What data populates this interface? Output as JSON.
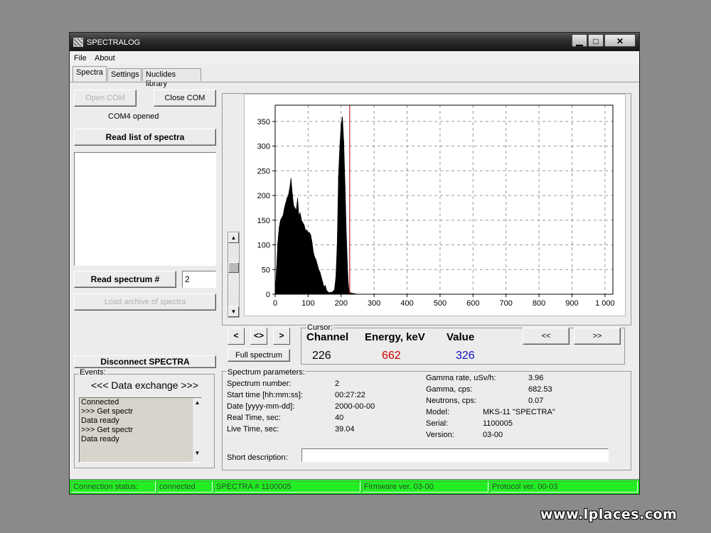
{
  "window": {
    "title": "SPECTRALOG",
    "controls": {
      "minimize": "▁",
      "maximize": "□",
      "close": "✕"
    }
  },
  "menu": [
    "File",
    "About"
  ],
  "tabs": [
    "Spectra",
    "Settings",
    "Nuclides library"
  ],
  "left_panel": {
    "open_com": "Open COM",
    "close_com": "Close COM",
    "com_status": "COM4 opened",
    "read_list": "Read list of spectra",
    "read_spectrum": "Read spectrum #",
    "spectrum_number_value": "2",
    "load_archive": "Load archive of spectra",
    "disconnect": "Disconnect SPECTRA",
    "events_label": "Events:",
    "data_exchange": "<<< Data exchange >>>",
    "events": [
      "Connected",
      ">>> Get spectr",
      "Data ready",
      ">>> Get spectr",
      "Data ready"
    ]
  },
  "chart_controls": {
    "prev": "<",
    "expand": "<>",
    "next": ">",
    "full_spectrum": "Full spectrum",
    "page_prev": "<<",
    "page_next": ">>"
  },
  "cursor": {
    "label": "Cursor:",
    "channel_label": "Channel",
    "energy_label": "Energy, keV",
    "value_label": "Value",
    "channel": "226",
    "energy": "662",
    "value": "326",
    "energy_color": "#d00000",
    "value_color": "#1010c0"
  },
  "params": {
    "label": "Spectrum parameters:",
    "left": [
      {
        "name": "Spectrum number:",
        "value": "2"
      },
      {
        "name": "Start time [hh:mm:ss]:",
        "value": "00:27:22"
      },
      {
        "name": "Date [yyyy-mm-dd]:",
        "value": "2000-00-00"
      },
      {
        "name": "Real Time, sec:",
        "value": "40"
      },
      {
        "name": "Live Time, sec:",
        "value": "39.04"
      }
    ],
    "right": [
      {
        "name": "Gamma rate, uSv/h:",
        "value": "3.96"
      },
      {
        "name": "Gamma, cps:",
        "value": "682.53"
      },
      {
        "name": "Neutrons, cps:",
        "value": "0.07"
      },
      {
        "name": "Model:",
        "value": "MKS-11 \"SPECTRA\""
      },
      {
        "name": "Serial:",
        "value": "1100005"
      },
      {
        "name": "Version:",
        "value": "03-00"
      }
    ],
    "short_description": "Short description:"
  },
  "statusbar": {
    "label": "Connection status:",
    "state": "connected",
    "device": "SPECTRA # 1100005",
    "firmware": "Firmware ver. 03-00",
    "protocol": "Protocol ver. 00-03",
    "color": "#22ee22"
  },
  "chart_data": {
    "type": "area",
    "xlim": [
      0,
      1024
    ],
    "ylim": [
      0,
      383
    ],
    "xticks": [
      0,
      100,
      200,
      300,
      400,
      500,
      600,
      700,
      800,
      900,
      1000
    ],
    "xtick_labels": [
      "0",
      "100",
      "200",
      "300",
      "400",
      "500",
      "600",
      "700",
      "800",
      "900",
      "1 000"
    ],
    "yticks": [
      0,
      50,
      100,
      150,
      200,
      250,
      300,
      350
    ],
    "grid": true,
    "cursor_channel": 226,
    "cursor_color": "#b00000",
    "series": [
      {
        "x": [
          0,
          4,
          8,
          12,
          16,
          20,
          24,
          28,
          32,
          36,
          40,
          44,
          48,
          52,
          56,
          60,
          64,
          68,
          72,
          76,
          80,
          84,
          88,
          92,
          96,
          100,
          104,
          108,
          112,
          116,
          120,
          124,
          128,
          132,
          136,
          140,
          144,
          148,
          152,
          156,
          160,
          164,
          168,
          172,
          176,
          180,
          184,
          188,
          192,
          196,
          200,
          204,
          208,
          212,
          216,
          220,
          222,
          224,
          226,
          228,
          230,
          232,
          236,
          240,
          244,
          248,
          252,
          256,
          264,
          272,
          300,
          400,
          600,
          800,
          1000,
          1024
        ],
        "values": [
          0,
          50,
          105,
          135,
          150,
          155,
          160,
          175,
          185,
          195,
          200,
          215,
          235,
          205,
          180,
          175,
          170,
          195,
          160,
          165,
          150,
          145,
          140,
          130,
          130,
          125,
          125,
          120,
          105,
          85,
          75,
          70,
          60,
          50,
          45,
          35,
          25,
          15,
          18,
          8,
          5,
          3,
          4,
          4,
          6,
          10,
          35,
          100,
          240,
          300,
          345,
          360,
          310,
          220,
          120,
          45,
          20,
          8,
          4,
          3,
          3,
          2,
          2,
          1,
          1,
          0,
          0,
          0,
          0,
          0,
          0,
          0,
          0,
          0,
          0,
          0
        ]
      }
    ]
  },
  "watermark": "www.lplaces.com"
}
